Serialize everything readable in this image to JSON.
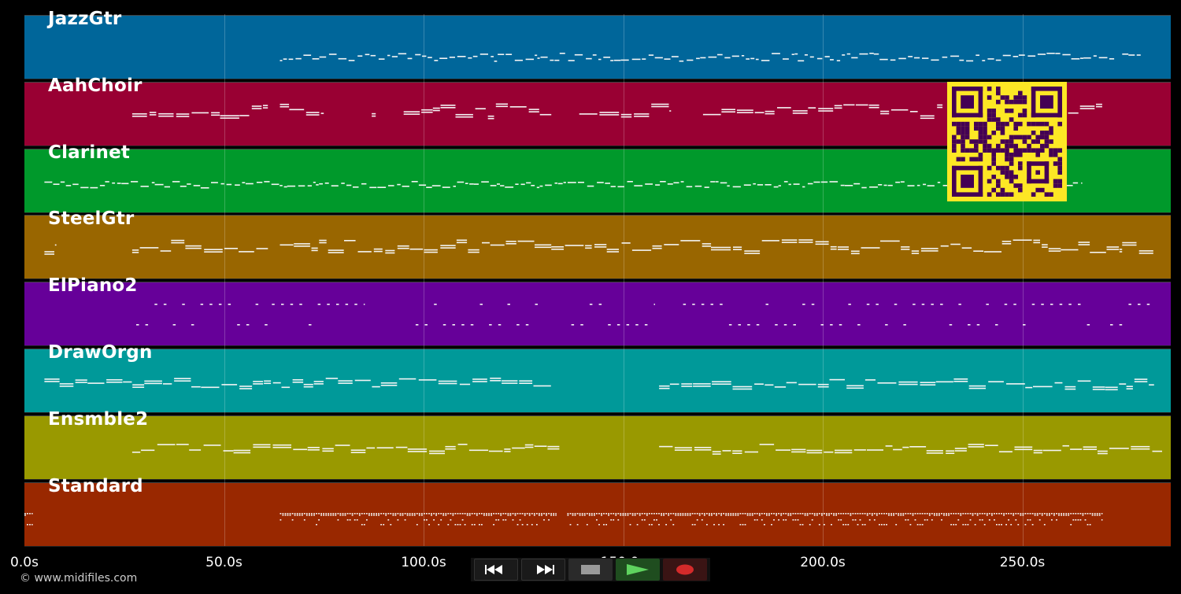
{
  "tracks": [
    {
      "name": "JazzGtr",
      "color": "#00669a"
    },
    {
      "name": "AahChoir",
      "color": "#990033"
    },
    {
      "name": "Clarinet",
      "color": "#00992b"
    },
    {
      "name": "SteelGtr",
      "color": "#996600"
    },
    {
      "name": "ElPiano2",
      "color": "#660099"
    },
    {
      "name": "DrawOrgn",
      "color": "#009999"
    },
    {
      "name": "Ensmble2",
      "color": "#999900"
    },
    {
      "name": "Standard",
      "color": "#992800"
    }
  ],
  "timeline": {
    "ticks": [
      "0.0s",
      "50.0s",
      "100.0s",
      "150.0s",
      "200.0s",
      "250.0s"
    ],
    "tick_seconds": [
      0,
      50,
      100,
      150,
      200,
      250
    ],
    "max_seconds": 287
  },
  "copyright": "© www.midifiles.com",
  "controls": {
    "rewind": "rewind-icon",
    "fast_forward": "fast-forward-icon",
    "stop": "stop-icon",
    "play": "play-icon",
    "record": "record-icon"
  },
  "qr_code": {
    "color": "#fde725",
    "module_color": "#440154"
  }
}
